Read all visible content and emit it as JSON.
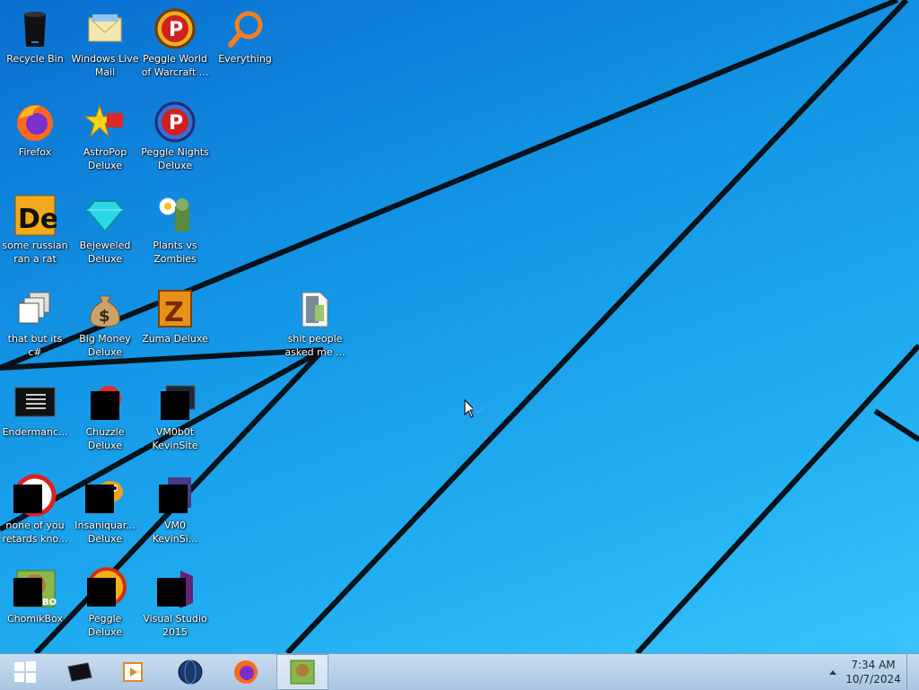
{
  "desktop_icons": [
    {
      "id": "recycle-bin",
      "label": "Recycle Bin",
      "icon": "recycle-bin-icon"
    },
    {
      "id": "windows-live-mail",
      "label": "Windows Live Mail",
      "icon": "mail-icon"
    },
    {
      "id": "peggle-world-of-warcraft",
      "label": "Peggle World of Warcraft ...",
      "icon": "peggle-icon"
    },
    {
      "id": "everything",
      "label": "Everything",
      "icon": "magnifier-icon"
    },
    {
      "id": "firefox",
      "label": "Firefox",
      "icon": "firefox-icon"
    },
    {
      "id": "astropop-deluxe",
      "label": "AstroPop Deluxe",
      "icon": "astropop-icon"
    },
    {
      "id": "peggle-nights-deluxe",
      "label": "Peggle Nights Deluxe",
      "icon": "peggle-nights-icon"
    },
    {
      "id": "some-russian-ran-a-rat",
      "label": "some russian ran a rat",
      "icon": "de-icon"
    },
    {
      "id": "bejeweled-deluxe",
      "label": "Bejeweled Deluxe",
      "icon": "gem-icon"
    },
    {
      "id": "plants-vs-zombies",
      "label": "Plants vs Zombies",
      "icon": "plant-icon"
    },
    {
      "id": "that-but-its-csharp",
      "label": "that but its c#",
      "icon": "stacked-windows-icon"
    },
    {
      "id": "big-money-deluxe",
      "label": "Big Money Deluxe",
      "icon": "money-bag-icon"
    },
    {
      "id": "zuma-deluxe",
      "label": "Zuma Deluxe",
      "icon": "zuma-icon"
    },
    {
      "id": "shit-people-asked-me",
      "label": "shit people asked me ...",
      "icon": "folder-icon"
    },
    {
      "id": "endermanch",
      "label": "Endermanc...",
      "icon": "console-icon"
    },
    {
      "id": "chuzzle-deluxe",
      "label": "Chuzzle Deluxe",
      "icon": "chuzzle-icon"
    },
    {
      "id": "vm0b0t-kevinsite",
      "label": "VM0b0t KevinSite",
      "icon": "monitor-icon"
    },
    {
      "id": "none-of-you",
      "label": "none of you retards kno...",
      "icon": "red-circle-icon"
    },
    {
      "id": "insaniquarium-deluxe",
      "label": "Insaniquar... Deluxe",
      "icon": "fish-icon"
    },
    {
      "id": "vm0-kevinsi",
      "label": "VM0 KevinSi...",
      "icon": "document-icon"
    },
    {
      "id": "chomikbox",
      "label": "ChomikBox",
      "icon": "chomik-icon"
    },
    {
      "id": "peggle-deluxe",
      "label": "Peggle Deluxe",
      "icon": "peggle-deluxe-icon"
    },
    {
      "id": "visual-studio-2015",
      "label": "Visual Studio 2015",
      "icon": "visual-studio-icon"
    }
  ],
  "taskbar": {
    "start_label": "Start",
    "buttons": [
      {
        "id": "start",
        "icon": "windows-logo-icon"
      },
      {
        "id": "console",
        "icon": "console-window-icon"
      },
      {
        "id": "media",
        "icon": "media-player-icon"
      },
      {
        "id": "globe",
        "icon": "globe-icon"
      },
      {
        "id": "firefox",
        "icon": "firefox-icon"
      },
      {
        "id": "chomikbox",
        "icon": "chomikbox-icon",
        "active": true
      }
    ],
    "clock": {
      "time": "7:34 AM",
      "date": "10/7/2024"
    }
  },
  "colors": {
    "desktop_accent": "#1496e6",
    "taskbar": "#bcd3ea"
  }
}
